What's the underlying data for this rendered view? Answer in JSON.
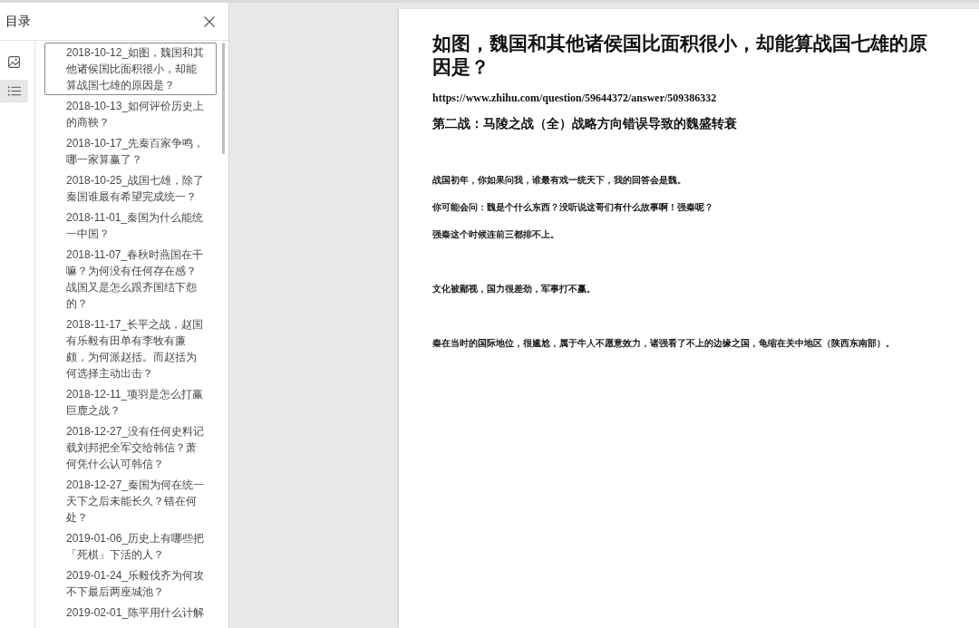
{
  "sidebar": {
    "title": "目录",
    "tabs": [
      {
        "kind": "thumbnails",
        "selected": false
      },
      {
        "kind": "outline",
        "selected": true
      }
    ],
    "outline": [
      {
        "label": "2018-10-12_如图，魏国和其他诸侯国比面积很小，却能算战国七雄的原因是？",
        "selected": true
      },
      {
        "label": "2018-10-13_如何评价历史上的商鞅？",
        "selected": false
      },
      {
        "label": "2018-10-17_先秦百家争鸣，哪一家算赢了？",
        "selected": false
      },
      {
        "label": "2018-10-25_战国七雄，除了秦国谁最有希望完成统一？",
        "selected": false
      },
      {
        "label": "2018-11-01_秦国为什么能统一中国？",
        "selected": false
      },
      {
        "label": "2018-11-07_春秋时燕国在干嘛？为何没有任何存在感？战国又是怎么跟齐国结下怨的？",
        "selected": false
      },
      {
        "label": "2018-11-17_长平之战，赵国有乐毅有田单有李牧有廉颇，为何派赵括。而赵括为何选择主动出击？",
        "selected": false
      },
      {
        "label": "2018-12-11_项羽是怎么打赢巨鹿之战？",
        "selected": false
      },
      {
        "label": "2018-12-27_没有任何史料记载刘邦把全军交给韩信？萧何凭什么认可韩信？",
        "selected": false
      },
      {
        "label": "2018-12-27_秦国为何在统一天下之后未能长久？错在何处？",
        "selected": false
      },
      {
        "label": "2019-01-06_历史上有哪些把「死棋」下活的人？",
        "selected": false
      },
      {
        "label": "2019-01-24_乐毅伐齐为何攻不下最后两座城池？",
        "selected": false
      },
      {
        "label": "2019-02-01_陈平用什么计解",
        "selected": false
      }
    ]
  },
  "document": {
    "title": "如图，魏国和其他诸侯国比面积很小，却能算战国七雄的原因是？",
    "url": "https://www.zhihu.com/question/59644372/answer/509386332",
    "subtitle": "第二战：马陵之战（全）战略方向错误导致的魏盛转衰",
    "paragraphs": [
      "战国初年，你如果问我，谁最有戏一统天下，我的回答会是魏。",
      "你可能会问：魏是个什么东西？没听说这哥们有什么故事啊！强秦呢？",
      "强秦这个时候连前三都排不上。",
      "文化被鄙视，国力很差劲，军事打不赢。",
      "秦在当时的国际地位，很尴尬，属于牛人不愿意效力，诸强看了不上的边缘之国，龟缩在关中地区（陕西东南部）。"
    ]
  }
}
